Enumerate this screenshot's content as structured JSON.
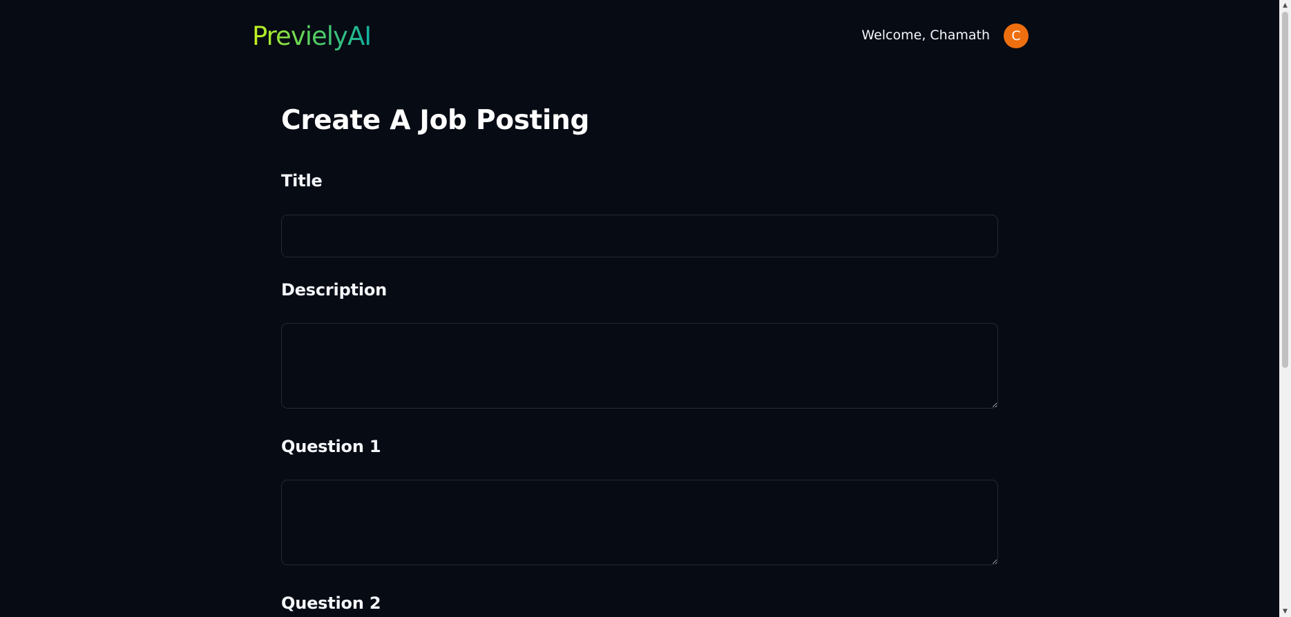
{
  "header": {
    "brand": "PrevielyAI",
    "welcome": "Welcome, Chamath",
    "avatar_initial": "C"
  },
  "form": {
    "title": "Create A Job Posting",
    "fields": [
      {
        "label": "Title",
        "value": "",
        "placeholder": ""
      },
      {
        "label": "Description",
        "value": "",
        "placeholder": ""
      },
      {
        "label": "Question 1",
        "value": "",
        "placeholder": ""
      },
      {
        "label": "Question 2",
        "value": "",
        "placeholder": ""
      }
    ]
  },
  "scrollbar": {
    "up_arrow": "▲",
    "down_arrow": "▼"
  },
  "colors": {
    "background": "#070b14",
    "avatar": "#ee6f0f",
    "brand_gradient_start": "#c7f21b",
    "brand_gradient_end": "#10b0a0",
    "field_border": "#222a38"
  }
}
